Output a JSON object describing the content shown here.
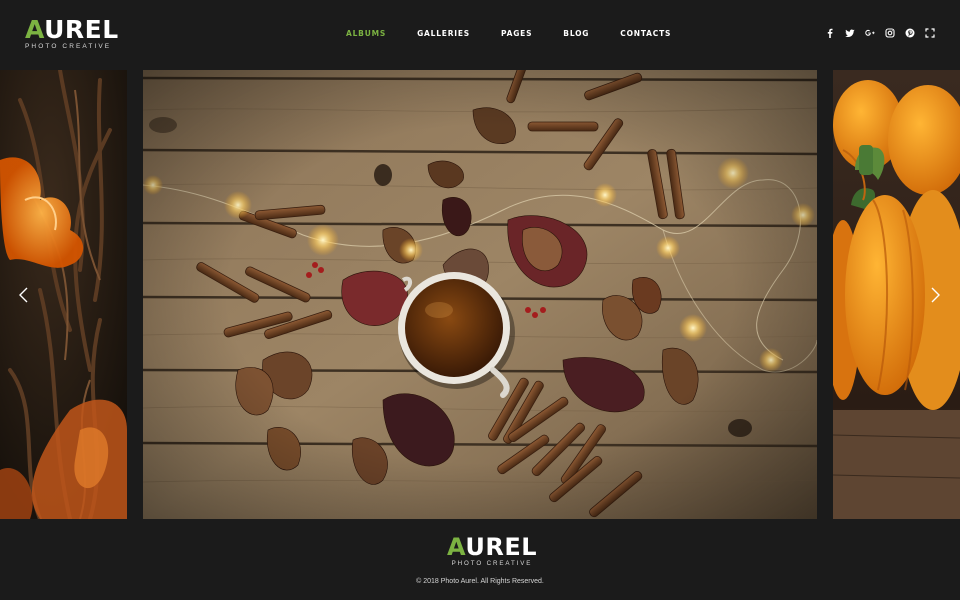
{
  "brand": {
    "logo_accent": "A",
    "logo_rest": "UREL",
    "tagline": "PHOTO CREATIVE",
    "accent_color": "#7cb342"
  },
  "nav": {
    "items": [
      {
        "label": "ALBUMS",
        "active": true
      },
      {
        "label": "GALLERIES",
        "active": false
      },
      {
        "label": "PAGES",
        "active": false
      },
      {
        "label": "BLOG",
        "active": false
      },
      {
        "label": "CONTACTS",
        "active": false
      }
    ]
  },
  "social": {
    "icons": [
      "facebook-icon",
      "twitter-icon",
      "google-plus-icon",
      "instagram-icon",
      "pinterest-icon",
      "fullscreen-icon"
    ]
  },
  "slider": {
    "slides": [
      {
        "name": "autumn-wreath-orange-peel",
        "position": "previous"
      },
      {
        "name": "tea-cup-cinnamon-leaves-lights",
        "position": "current"
      },
      {
        "name": "orange-pumpkins",
        "position": "next"
      }
    ],
    "prev_icon": "chevron-left-icon",
    "next_icon": "chevron-right-icon"
  },
  "footer": {
    "logo_accent": "A",
    "logo_rest": "UREL",
    "tagline": "PHOTO CREATIVE",
    "copyright": "© 2018 Photo Aurel. All Rights Reserved."
  }
}
